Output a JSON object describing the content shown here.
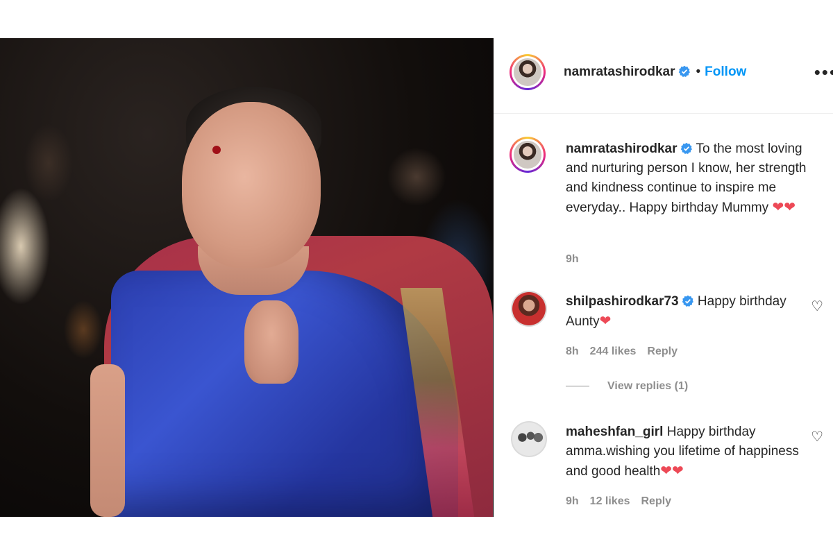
{
  "header": {
    "username": "namratashirodkar",
    "separator": "•",
    "follow_label": "Follow",
    "more_icon": "more-horizontal-icon"
  },
  "caption": {
    "username": "namratashirodkar",
    "text": "To the most loving and nurturing person I know, her strength and kindness continue to inspire me everyday.. Happy birthday Mummy",
    "emojis": "❤❤",
    "time": "9h"
  },
  "comments": [
    {
      "username": "shilpashirodkar73",
      "verified": true,
      "text": "Happy birthday Aunty",
      "emojis": "❤",
      "time": "8h",
      "likes": "244 likes",
      "reply_label": "Reply",
      "view_replies": "View replies (1)"
    },
    {
      "username": "maheshfan_girl",
      "verified": false,
      "text": "Happy birthday amma.wishing you lifetime of happiness and good health",
      "emojis": "❤❤",
      "time": "9h",
      "likes": "12 likes",
      "reply_label": "Reply"
    }
  ],
  "colors": {
    "follow": "#0095f6",
    "verified": "#3897f0",
    "meta": "#8e8e8e",
    "heart": "#ed4956"
  }
}
